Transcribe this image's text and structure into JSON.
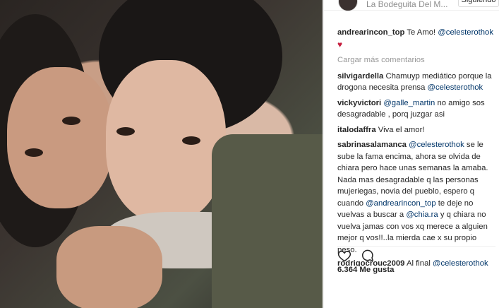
{
  "header": {
    "title": "La Bodeguita Del M...",
    "follow_label": "Siguiendo"
  },
  "caption": {
    "user": "andrearincon_top",
    "text": "Te Amo!",
    "mention": "@celesterothok",
    "heart": "♥"
  },
  "load_more": "Cargar más comentarios",
  "comments": [
    {
      "user": "silvigardella",
      "parts": [
        "Chamuyp mediático porque la drogona necesita prensa",
        "@celesterothok",
        ""
      ]
    },
    {
      "user": "vickyvictori",
      "parts": [
        "",
        "@galle_martin",
        "no amigo sos desagradable , porq juzgar asi"
      ]
    },
    {
      "user": "italodaffra",
      "parts": [
        "Viva el amor!",
        "",
        ""
      ]
    },
    {
      "user": "sabrinasalamanca",
      "parts": [
        "",
        "@celesterothok",
        "se le sube la fama encima, ahora se olvida de chiara pero hace unas semanas la amaba. Nada mas desagradable q las personas mujeriegas, novia del pueblo, espero q cuando"
      ],
      "more": [
        "@andrearincon_top",
        "te deje no vuelvas a buscar a",
        "@chia.ra",
        "y q chiara no vuelva jamas con vos xq merece a alguien mejor q vos!!..la mierda cae x su propio peso."
      ]
    },
    {
      "user": "rodrigocrouc2009",
      "parts": [
        "Al final",
        "@celesterothok",
        ""
      ]
    }
  ],
  "likes": "6.364 Me gusta",
  "icons": {
    "like": "heart-outline-icon",
    "comment": "comment-bubble-icon"
  }
}
